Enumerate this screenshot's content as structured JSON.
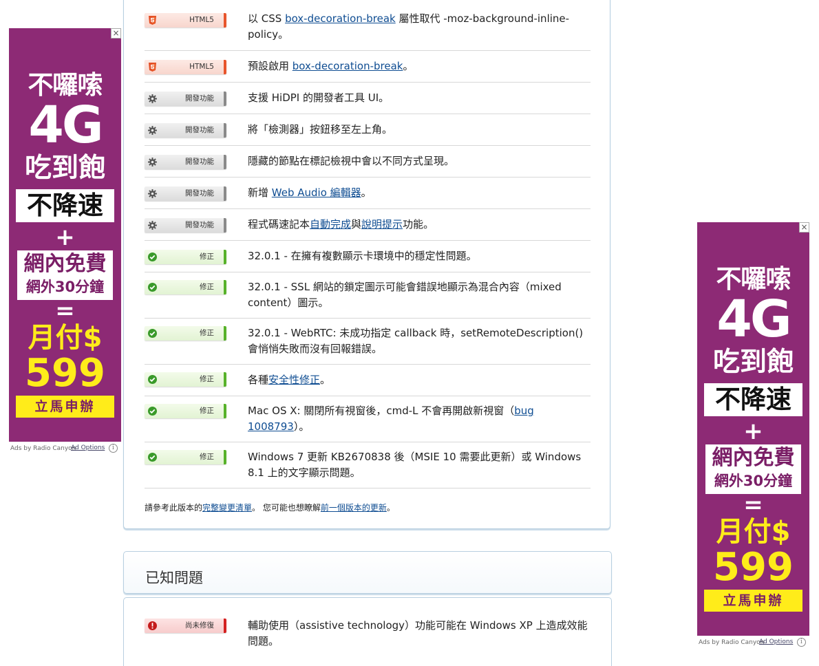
{
  "release_notes": {
    "rows": [
      {
        "tag": "HTML5",
        "tag_type": "html5",
        "text_parts": [
          "以 CSS ",
          "box-decoration-break",
          " 屬性取代 -moz-background-inline-policy。"
        ]
      },
      {
        "tag": "HTML5",
        "tag_type": "html5",
        "text_parts": [
          "預設啟用 ",
          "box-decoration-break",
          "。"
        ]
      },
      {
        "tag": "開發功能",
        "tag_type": "dev",
        "text_parts": [
          "支援 HiDPI 的開發者工具 UI。"
        ]
      },
      {
        "tag": "開發功能",
        "tag_type": "dev",
        "text_parts": [
          "將「檢測器」按鈕移至左上角。"
        ]
      },
      {
        "tag": "開發功能",
        "tag_type": "dev",
        "text_parts": [
          "隱藏的節點在標記檢視中會以不同方式呈現。"
        ]
      },
      {
        "tag": "開發功能",
        "tag_type": "dev",
        "text_parts": [
          "新增 ",
          "Web Audio 編輯器",
          "。"
        ]
      },
      {
        "tag": "開發功能",
        "tag_type": "dev",
        "text_parts": [
          "程式碼速記本",
          "自動完成",
          "與",
          "說明提示",
          "功能。"
        ]
      },
      {
        "tag": "修正",
        "tag_type": "fix",
        "text_parts": [
          "32.0.1 - 在擁有複數顯示卡環境中的穩定性問題。"
        ]
      },
      {
        "tag": "修正",
        "tag_type": "fix",
        "text_parts": [
          "32.0.1 - SSL 網站的鎖定圖示可能會錯誤地顯示為混合內容（mixed content）圖示。"
        ]
      },
      {
        "tag": "修正",
        "tag_type": "fix",
        "text_parts": [
          "32.0.1 - WebRTC: 未成功指定 callback 時，setRemoteDescription() 會悄悄失敗而沒有回報錯誤。"
        ]
      },
      {
        "tag": "修正",
        "tag_type": "fix",
        "text_parts": [
          "各種",
          "安全性修正",
          "。"
        ]
      },
      {
        "tag": "修正",
        "tag_type": "fix",
        "text_parts": [
          "Mac OS X: 關閉所有視窗後，cmd-L 不會再開啟新視窗（",
          "bug 1008793",
          "）。"
        ]
      },
      {
        "tag": "修正",
        "tag_type": "fix",
        "text_parts": [
          "Windows 7 更新 KB2670838 後（MSIE 10 需要此更新）或 Windows 8.1 上的文字顯示問題。"
        ]
      }
    ],
    "footnote": {
      "prefix": "請參考此版本的",
      "link1": "完整變更清單",
      "middle": "。 您可能也想瞭解",
      "link2": "前一個版本的更新",
      "suffix": "。"
    }
  },
  "known_issues": {
    "title": "已知問題",
    "rows": [
      {
        "tag": "尚未修復",
        "tag_type": "known",
        "text": "輔助使用（assistive technology）功能可能在 Windows XP 上造成效能問題。"
      }
    ]
  },
  "ad": {
    "close": "×",
    "line1": "不囉嗦",
    "big": "4G",
    "line3": "吃到飽",
    "box": "不降速",
    "plus": "+",
    "box2_line1": "網內免費",
    "box2_line2": "網外30分鐘",
    "eq": "=",
    "price1": "月付$",
    "price2": "599",
    "cta": "立馬申辦",
    "by": "Ads by Radio Canyon",
    "options": "Ad Options",
    "info": "i"
  },
  "colors": {
    "link": "#0f4d92",
    "ad_bg": "#8d2a75",
    "ad_yellow": "#ffec1a",
    "html5": "#e8552c",
    "dev": "#8a8a8a",
    "fix": "#57b22a",
    "known": "#d42222"
  },
  "icons": {
    "html5": "html5-shield-icon",
    "dev": "gear-icon",
    "fix": "check-circle-icon",
    "known": "exclamation-circle-icon"
  }
}
